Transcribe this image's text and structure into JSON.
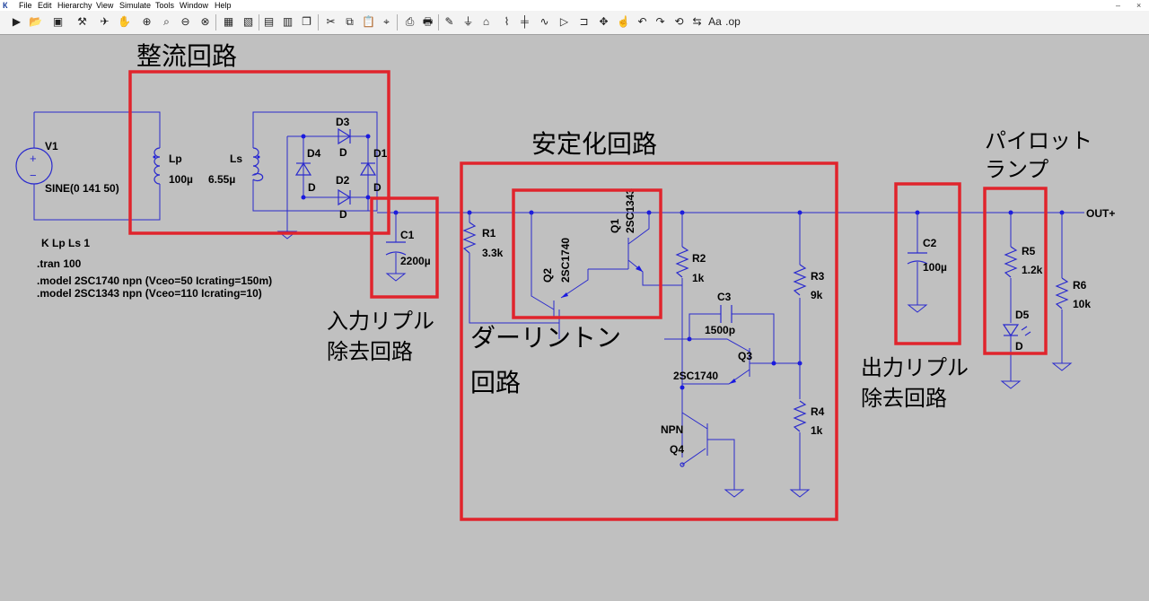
{
  "menu": {
    "items": [
      "File",
      "Edit",
      "Hierarchy",
      "View",
      "Simulate",
      "Tools",
      "Window",
      "Help"
    ],
    "window_controls": [
      "–",
      "×"
    ]
  },
  "toolbar": {
    "icons": [
      "run-icon",
      "open-icon",
      "save-icon",
      "control-panel-icon",
      "run-man-icon",
      "hand-icon",
      "zoom-in-icon",
      "zoom-pan-icon",
      "zoom-out-icon",
      "zoom-fit-icon",
      "autorange-icon",
      "tile-horizontal-icon",
      "tile-vertical-icon",
      "cascade-icon",
      "cut-icon",
      "copy-icon",
      "paste-icon",
      "find-icon",
      "print-setup-icon",
      "print-icon",
      "draw-wire-icon",
      "ground-icon",
      "label-net-icon",
      "resistor-icon",
      "capacitor-icon",
      "inductor-icon",
      "diode-icon",
      "component-icon",
      "move-icon",
      "drag-icon",
      "undo-icon",
      "redo-icon",
      "rotate-icon",
      "mirror-icon",
      "text-icon",
      "spice-directive-icon"
    ]
  },
  "schematic": {
    "components": {
      "V1": {
        "name": "V1",
        "value": "SINE(0 141 50)"
      },
      "Lp": {
        "name": "Lp",
        "value": "100µ"
      },
      "Ls": {
        "name": "Ls",
        "value": "6.55µ"
      },
      "D1": {
        "name": "D1",
        "value": "D"
      },
      "D2": {
        "name": "D2",
        "value": "D"
      },
      "D3": {
        "name": "D3",
        "value": "D"
      },
      "D4": {
        "name": "D4",
        "value": "D"
      },
      "C1": {
        "name": "C1",
        "value": "2200µ"
      },
      "R1": {
        "name": "R1",
        "value": "3.3k"
      },
      "Q1": {
        "name": "Q1",
        "value": "2SC1343"
      },
      "Q2": {
        "name": "Q2",
        "value": "2SC1740"
      },
      "R2": {
        "name": "R2",
        "value": "1k"
      },
      "C3": {
        "name": "C3",
        "value": "1500p"
      },
      "Q3": {
        "name": "Q3",
        "value": "2SC1740"
      },
      "R3": {
        "name": "R3",
        "value": "9k"
      },
      "R4": {
        "name": "R4",
        "value": "1k"
      },
      "Q4": {
        "name": "Q4",
        "value": "NPN"
      },
      "C2": {
        "name": "C2",
        "value": "100µ"
      },
      "R5": {
        "name": "R5",
        "value": "1.2k"
      },
      "D5": {
        "name": "D5",
        "value": "D"
      },
      "R6": {
        "name": "R6",
        "value": "10k"
      }
    },
    "net_label": "OUT+",
    "directives": [
      "K Lp Ls 1",
      ".tran 100",
      ".model 2SC1740 npn (Vceo=50 Icrating=150m)",
      ".model 2SC1343 npn (Vceo=110 Icrating=10)"
    ]
  },
  "annotations": {
    "rectifier": "整流回路",
    "stabilizer": "安定化回路",
    "pilot_lamp": [
      "パイロット",
      "ランプ"
    ],
    "input_ripple": [
      "入力リプル",
      "除去回路"
    ],
    "darlington": [
      "ダーリントン",
      "回路"
    ],
    "output_ripple": [
      "出力リプル",
      "除去回路"
    ]
  },
  "colors": {
    "wire": "#2a2acd",
    "highlight": "#e0242c",
    "background": "#c0c0c0"
  }
}
